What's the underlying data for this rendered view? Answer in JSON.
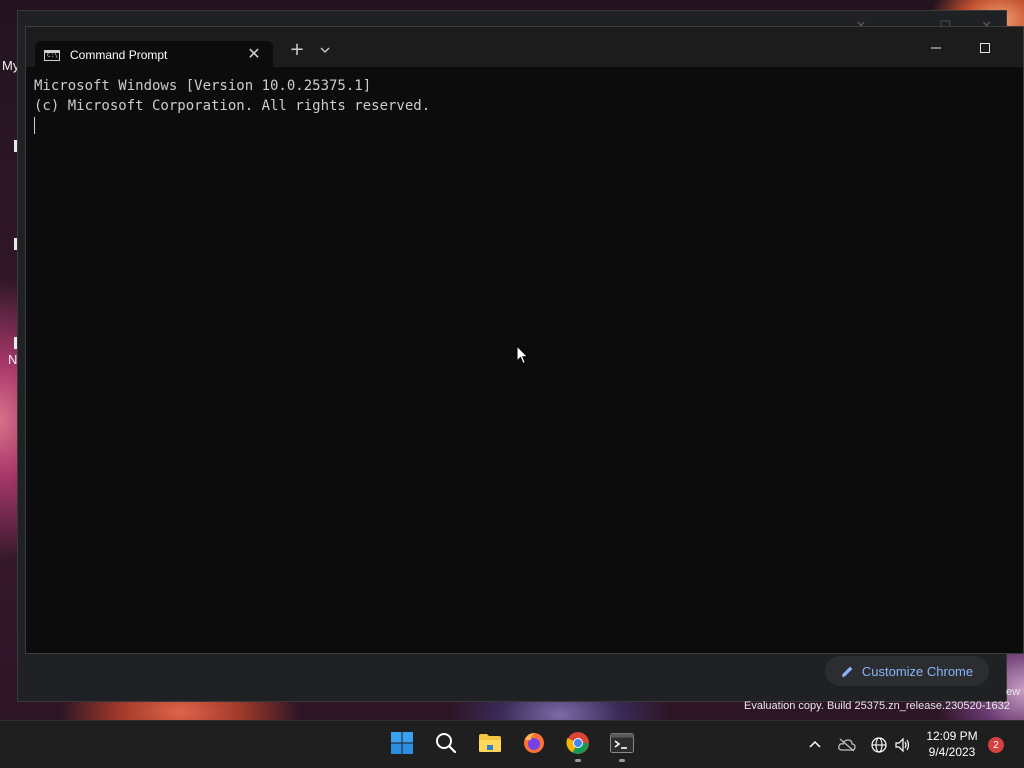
{
  "desktop": {
    "label_top": "My",
    "label_mid": "N"
  },
  "background_window": {
    "customize_chrome_label": "Customize Chrome"
  },
  "terminal": {
    "tab_title": "Command Prompt",
    "console_lines": [
      "Microsoft Windows [Version 10.0.25375.1]",
      "(c) Microsoft Corporation. All rights reserved."
    ],
    "tab_icon_text": "C:\\",
    "new_tab_glyph": "+",
    "close_glyph": "✕"
  },
  "watermark": {
    "text": "Evaluation copy. Build 25375.zn_release.230520-1632",
    "tail": "ew"
  },
  "taskbar": {
    "apps": [
      {
        "name": "start",
        "icon": "windows-logo-icon"
      },
      {
        "name": "search",
        "icon": "search-icon"
      },
      {
        "name": "file-explorer",
        "icon": "folder-icon"
      },
      {
        "name": "firefox",
        "icon": "firefox-icon"
      },
      {
        "name": "chrome",
        "icon": "chrome-icon",
        "running": true
      },
      {
        "name": "terminal",
        "icon": "terminal-icon",
        "running": true
      }
    ],
    "time": "12:09 PM",
    "date": "9/4/2023",
    "notification_count": "2"
  },
  "colors": {
    "terminal_bg": "#0c0c0c",
    "terminal_text": "#cccccc",
    "chrome_link": "#8ab4f8",
    "taskbar_bg": "#1f1f1f",
    "badge": "#d4413f"
  }
}
